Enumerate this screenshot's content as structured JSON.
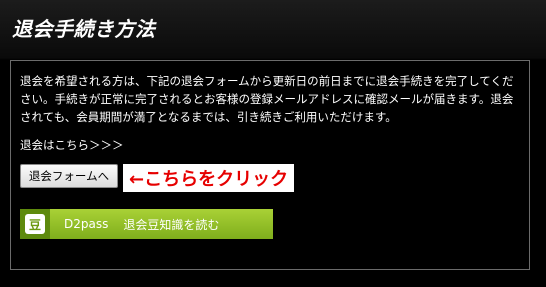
{
  "page": {
    "title": "退会手続き方法"
  },
  "panel": {
    "description": "退会を希望される方は、下記の退会フォームから更新日の前日までに退会手続きを完了してください。手続きが正常に完了されるとお客様の登録メールアドレスに確認メールが届きます。退会されても、会員期間が満了となるまでは、引き続きご利用いただけます。",
    "link_text": "退会はこちら＞＞＞",
    "form_button_label": "退会フォームへ",
    "annotation": "←こちらをクリック"
  },
  "banner": {
    "icon_glyph": "豆",
    "brand": "D2pass",
    "label": "退会豆知識を読む",
    "colors": {
      "green_light": "#a9d136",
      "green_dark": "#7fae1c",
      "icon_bg": "#5e8a0d"
    }
  },
  "colors": {
    "annotation_text": "#e60000",
    "panel_border": "#6b6b6b",
    "background": "#000000"
  }
}
